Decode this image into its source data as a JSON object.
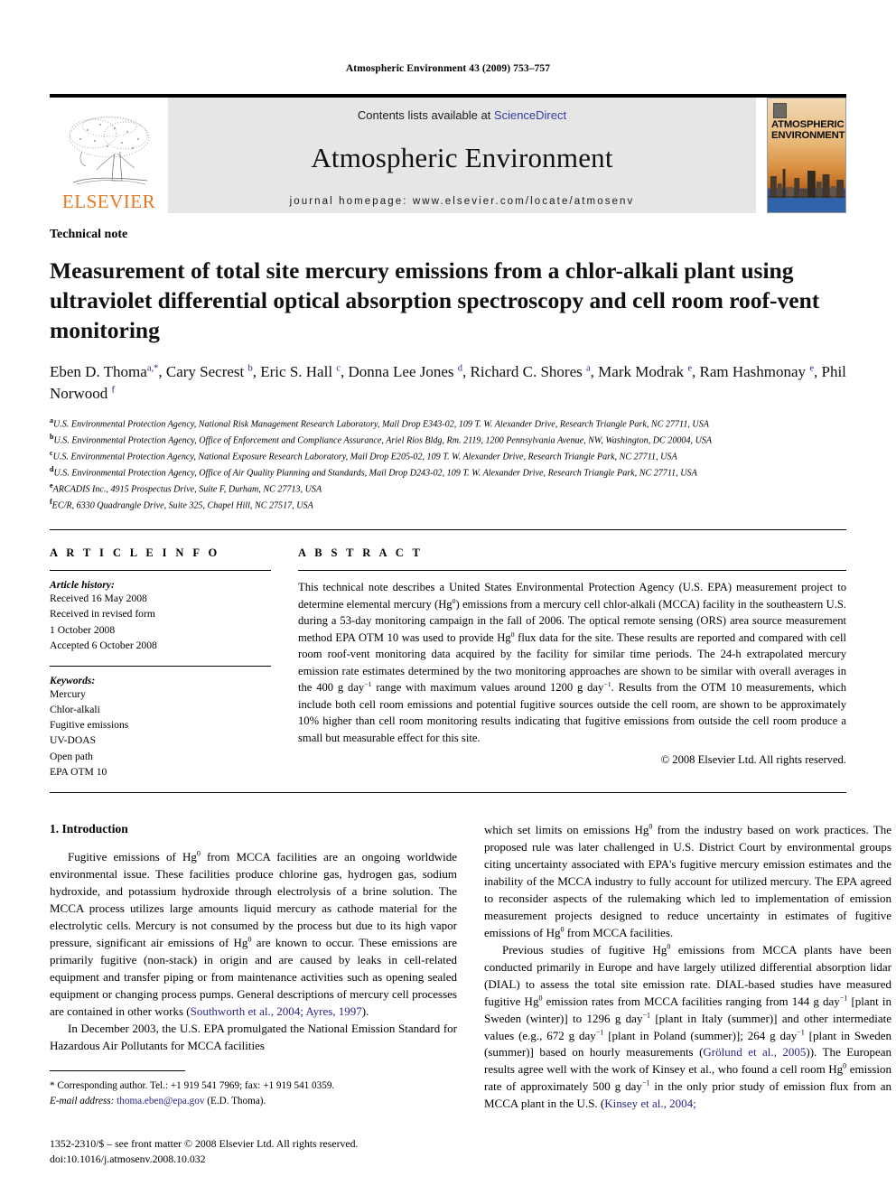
{
  "running_head": "Atmospheric Environment 43 (2009) 753–757",
  "header": {
    "contents_prefix": "Contents lists available at ",
    "sciencedirect": "ScienceDirect",
    "journal_title": "Atmospheric Environment",
    "homepage": "journal homepage: www.elsevier.com/locate/atmosenv",
    "elsevier_wordmark": "ELSEVIER",
    "cover_title_line1": "ATMOSPHERIC",
    "cover_title_line2": "ENVIRONMENT",
    "link_color": "#3a3aa8",
    "band_color": "#e6e6e6",
    "elsevier_orange": "#E87722"
  },
  "article": {
    "type_label": "Technical note",
    "title": "Measurement of total site mercury emissions from a chlor-alkali plant using ultraviolet differential optical absorption spectroscopy and cell room roof-vent monitoring",
    "authors": "Eben D. Thoma a,*, Cary Secrest b, Eric S. Hall c, Donna Lee Jones d, Richard C. Shores a, Mark Modrak e, Ram Hashmonay e, Phil Norwood f",
    "affiliations": [
      {
        "mark": "a",
        "text": "U.S. Environmental Protection Agency, National Risk Management Research Laboratory, Mail Drop E343-02, 109 T. W. Alexander Drive, Research Triangle Park, NC 27711, USA"
      },
      {
        "mark": "b",
        "text": "U.S. Environmental Protection Agency, Office of Enforcement and Compliance Assurance, Ariel Rios Bldg, Rm. 2119, 1200 Pennsylvania Avenue, NW, Washington, DC 20004, USA"
      },
      {
        "mark": "c",
        "text": "U.S. Environmental Protection Agency, National Exposure Research Laboratory, Mail Drop E205-02, 109 T. W. Alexander Drive, Research Triangle Park, NC 27711, USA"
      },
      {
        "mark": "d",
        "text": "U.S. Environmental Protection Agency, Office of Air Quality Planning and Standards, Mail Drop D243-02, 109 T. W. Alexander Drive, Research Triangle Park, NC 27711, USA"
      },
      {
        "mark": "e",
        "text": "ARCADIS Inc., 4915 Prospectus Drive, Suite F, Durham, NC 27713, USA"
      },
      {
        "mark": "f",
        "text": "EC/R, 6330 Quadrangle Drive, Suite 325, Chapel Hill, NC 27517, USA"
      }
    ]
  },
  "article_info": {
    "heading": "A R T I C L E   I N F O",
    "history_label": "Article history:",
    "history_lines": [
      "Received 16 May 2008",
      "Received in revised form",
      "1 October 2008",
      "Accepted 6 October 2008"
    ],
    "keywords_label": "Keywords:",
    "keywords": [
      "Mercury",
      "Chlor-alkali",
      "Fugitive emissions",
      "UV-DOAS",
      "Open path",
      "EPA OTM 10"
    ]
  },
  "abstract": {
    "heading": "A B S T R A C T",
    "paragraph_1": "This technical note describes a United States Environmental Protection Agency (U.S. EPA) measurement project to determine elemental mercury (Hg",
    "paragraph_2": ") emissions from a mercury cell chlor-alkali (MCCA) facility in the southeastern U.S. during a 53-day monitoring campaign in the fall of 2006. The optical remote sensing (ORS) area source measurement method EPA OTM 10 was used to provide Hg",
    "paragraph_3": " flux data for the site. These results are reported and compared with cell room roof-vent monitoring data acquired by the facility for similar time periods. The 24-h extrapolated mercury emission rate estimates determined by the two monitoring approaches are shown to be similar with overall averages in the 400 g day",
    "paragraph_4": " range with maximum values around 1200 g day",
    "paragraph_5": ". Results from the OTM 10 measurements, which include both cell room emissions and potential fugitive sources outside the cell room, are shown to be approximately 10% higher than cell room monitoring results indicating that fugitive emissions from outside the cell room produce a small but measurable effect for this site.",
    "copyright": "© 2008 Elsevier Ltd. All rights reserved."
  },
  "body": {
    "section_1_heading": "1. Introduction",
    "left_p1_a": "Fugitive emissions of Hg",
    "left_p1_b": " from MCCA facilities are an ongoing worldwide environmental issue. These facilities produce chlorine gas, hydrogen gas, sodium hydroxide, and potassium hydroxide through electrolysis of a brine solution. The MCCA process utilizes large amounts liquid mercury as cathode material for the electrolytic cells. Mercury is not consumed by the process but due to its high vapor pressure, significant air emissions of Hg",
    "left_p1_c": " are known to occur. These emissions are primarily fugitive (non-stack) in origin and are caused by leaks in cell-related equipment and transfer piping or from maintenance activities such as opening sealed equipment or changing process pumps. General descriptions of mercury cell processes are contained in other works (",
    "left_p1_cite": "Southworth et al., 2004; Ayres, 1997",
    "left_p1_d": ").",
    "left_p2": "In December 2003, the U.S. EPA promulgated the National Emission Standard for Hazardous Air Pollutants for MCCA facilities",
    "right_p1_a": "which set limits on emissions Hg",
    "right_p1_b": " from the industry based on work practices. The proposed rule was later challenged in U.S. District Court by environmental groups citing uncertainty associated with EPA's fugitive mercury emission estimates and the inability of the MCCA industry to fully account for utilized mercury. The EPA agreed to reconsider aspects of the rulemaking which led to implementation of emission measurement projects designed to reduce uncertainty in estimates of fugitive emissions of Hg",
    "right_p1_c": " from MCCA facilities.",
    "right_p2_a": "Previous studies of fugitive Hg",
    "right_p2_b": " emissions from MCCA plants have been conducted primarily in Europe and have largely utilized differential absorption lidar (DIAL) to assess the total site emission rate. DIAL-based studies have measured fugitive Hg",
    "right_p2_c": " emission rates from MCCA facilities ranging from 144 g day",
    "right_p2_d": " [plant in Sweden (winter)] to 1296 g day",
    "right_p2_e": " [plant in Italy (summer)] and other intermediate values (e.g., 672 g day",
    "right_p2_f": " [plant in Poland (summer)]; 264 g day",
    "right_p2_g": " [plant in Sweden (summer)] based on hourly measurements (",
    "right_p2_cite1": "Grölund et al., 2005",
    "right_p2_h": ")). The European results agree well with the work of Kinsey et al., who found a cell room Hg",
    "right_p2_i": " emission rate of approximately 500 g day",
    "right_p2_j": " in the only prior study of emission flux from an MCCA plant in the U.S. (",
    "right_p2_cite2": "Kinsey et al., 2004;",
    "superscript_0": "0",
    "superscript_minus1": "−1"
  },
  "footnotes": {
    "corresponding": "* Corresponding author. Tel.: +1 919 541 7969; fax: +1 919 541 0359.",
    "email_label": "E-mail address:",
    "email": "thoma.eben@epa.gov",
    "email_suffix": "(E.D. Thoma)."
  },
  "footer": {
    "issn_line": "1352-2310/$ – see front matter © 2008 Elsevier Ltd. All rights reserved.",
    "doi_line": "doi:10.1016/j.atmosenv.2008.10.032"
  }
}
